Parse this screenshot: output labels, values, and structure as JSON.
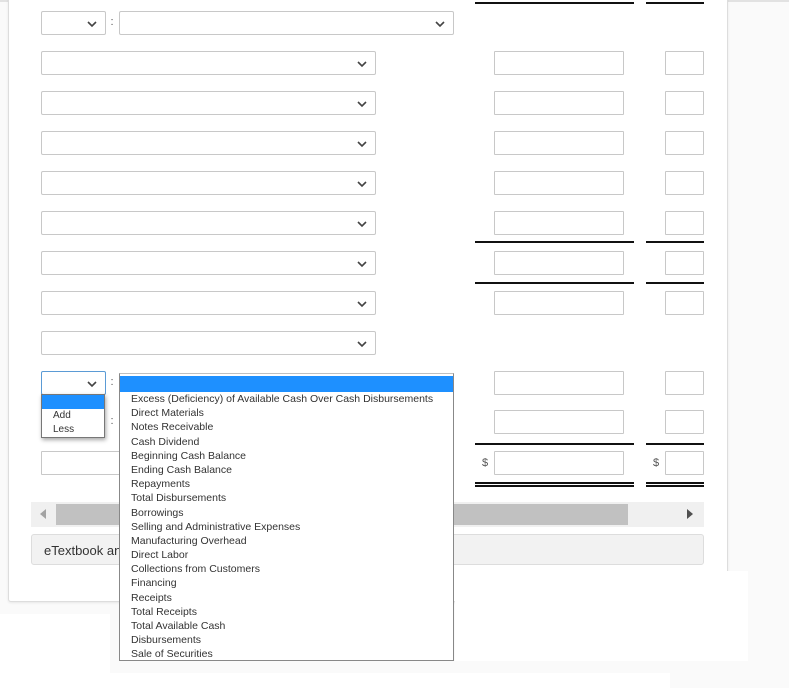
{
  "form": {
    "rows": [
      {
        "type": "addless-row",
        "prefix_value": "",
        "label_value": ""
      },
      {
        "type": "label-row",
        "label_value": ""
      },
      {
        "type": "label-row",
        "label_value": ""
      },
      {
        "type": "label-row",
        "label_value": ""
      },
      {
        "type": "label-row",
        "label_value": ""
      },
      {
        "type": "label-row",
        "label_value": ""
      },
      {
        "type": "label-row",
        "label_value": ""
      },
      {
        "type": "label-row",
        "label_value": ""
      },
      {
        "type": "label-row",
        "label_value": ""
      },
      {
        "type": "addless-row",
        "prefix_value": "",
        "label_value": ""
      },
      {
        "type": "addless-row",
        "prefix_value": "",
        "label_value": ""
      },
      {
        "type": "total-row",
        "label_value": ""
      }
    ],
    "colon": ":",
    "currency_symbol": "$"
  },
  "prefix_dropdown": {
    "options": [
      "",
      "Add",
      "Less"
    ],
    "highlighted_index": 0
  },
  "label_dropdown": {
    "options": [
      "",
      "Excess (Deficiency) of Available Cash Over Cash Disbursements",
      "Direct Materials",
      "Notes Receivable",
      "Cash Dividend",
      "Beginning Cash Balance",
      "Ending Cash Balance",
      "Repayments",
      "Total Disbursements",
      "Borrowings",
      "Selling and Administrative Expenses",
      "Manufacturing Overhead",
      "Direct Labor",
      "Collections from Customers",
      "Financing",
      "Receipts",
      "Total Receipts",
      "Total Available Cash",
      "Disbursements",
      "Sale of Securities"
    ],
    "highlighted_index": 0
  },
  "footer": {
    "etextbook_label": "eTextbook and Media"
  },
  "colors": {
    "highlight": "#1e90ff",
    "border": "#c8c8c8",
    "focus_border": "#5b9bd5"
  }
}
